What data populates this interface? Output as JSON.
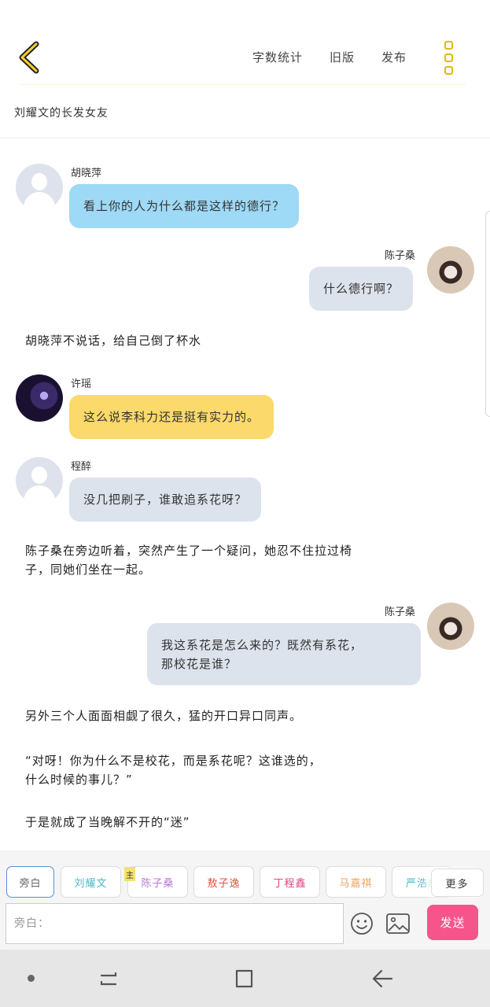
{
  "header": {
    "actions": [
      "字数统计",
      "旧版",
      "发布"
    ],
    "story_title": "刘耀文的长发女友"
  },
  "messages": [
    {
      "name": "胡晓萍",
      "text": "看上你的人为什么都是这样的德行？",
      "side": "left",
      "color": "blue",
      "avatar": "default-avatar"
    },
    {
      "name": "陈子桑",
      "text": "什么德行啊？",
      "side": "right",
      "color": "grey",
      "avatar": "photo"
    },
    {
      "narration": "胡晓萍不说话，给自己倒了杯水"
    },
    {
      "name": "许瑶",
      "text": "这么说李科力还是挺有实力的。",
      "side": "left",
      "color": "yellow",
      "avatar": "photo"
    },
    {
      "name": "程醉",
      "text": "没几把刷子，谁敢追系花呀？",
      "side": "left",
      "color": "grey",
      "avatar": "default-avatar"
    },
    {
      "narration_lines": [
        "陈子桑在旁边听着，突然产生了一个疑问，她忍不住拉过椅",
        "子，同她们坐在一起。"
      ]
    },
    {
      "name": "陈子桑",
      "text_lines": [
        "我这系花是怎么来的？既然有系花，",
        "那校花是谁？"
      ],
      "side": "right",
      "color": "grey",
      "avatar": "photo"
    },
    {
      "narration": "另外三个人面面相觑了很久，猛的开口异口同声。"
    },
    {
      "narration_lines": [
        "“对呀！你为什么不是校花，而是系花呢？这谁选的，",
        "什么时候的事儿？”"
      ]
    },
    {
      "narration": "于是就成了当晚解不开的“迷”"
    }
  ],
  "roles": [
    {
      "label": "旁白",
      "color": "#666666",
      "active": true
    },
    {
      "label": "刘耀文",
      "color": "#4fb7c9"
    },
    {
      "label": "陈子桑",
      "color": "#b77bd6",
      "badge": "主"
    },
    {
      "label": "敖子逸",
      "color": "#e8503a"
    },
    {
      "label": "丁程鑫",
      "color": "#e0457c"
    },
    {
      "label": "马嘉祺",
      "color": "#f0a35a"
    },
    {
      "label": "严浩翔",
      "color": "#4fb7c9"
    }
  ],
  "more_label": "更多",
  "input": {
    "placeholder": "旁白："
  },
  "send_label": "发送",
  "icons": [
    "back-chevron-icon",
    "more-vertical-icon",
    "emoji-icon",
    "image-icon",
    "recent-apps-icon",
    "home-icon",
    "back-icon"
  ],
  "colors": {
    "accent": "#e2b817",
    "send": "#f5558a",
    "bubble_blue": "#9ed9f5",
    "bubble_grey": "#dde3ec",
    "bubble_yellow": "#fbd96a"
  }
}
